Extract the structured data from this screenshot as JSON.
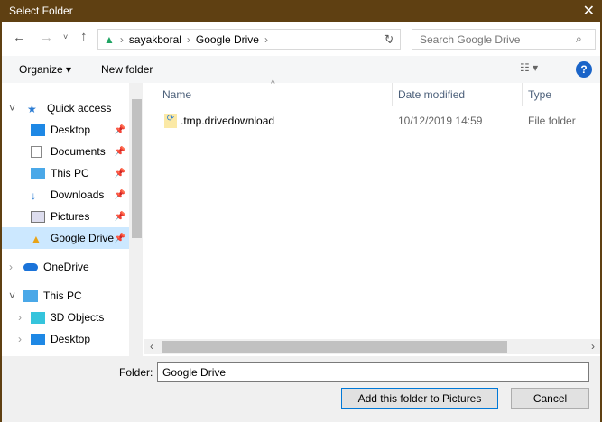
{
  "window": {
    "title": "Select Folder"
  },
  "address": {
    "crumbs": [
      "sayakboral",
      "Google Drive"
    ],
    "search_placeholder": "Search Google Drive"
  },
  "toolbar": {
    "organize": "Organize ▾",
    "new_folder": "New folder"
  },
  "tree": {
    "quick_access": "Quick access",
    "items": [
      "Desktop",
      "Documents",
      "This PC",
      "Downloads",
      "Pictures",
      "Google Drive"
    ],
    "onedrive": "OneDrive",
    "this_pc": "This PC",
    "pc_items": [
      "3D Objects",
      "Desktop"
    ]
  },
  "list": {
    "columns": [
      "Name",
      "Date modified",
      "Type"
    ],
    "rows": [
      {
        "name": ".tmp.drivedownload",
        "date": "10/12/2019 14:59",
        "type": "File folder"
      }
    ]
  },
  "footer": {
    "folder_label": "Folder:",
    "folder_value": "Google Drive",
    "ok": "Add this folder to Pictures",
    "cancel": "Cancel"
  }
}
